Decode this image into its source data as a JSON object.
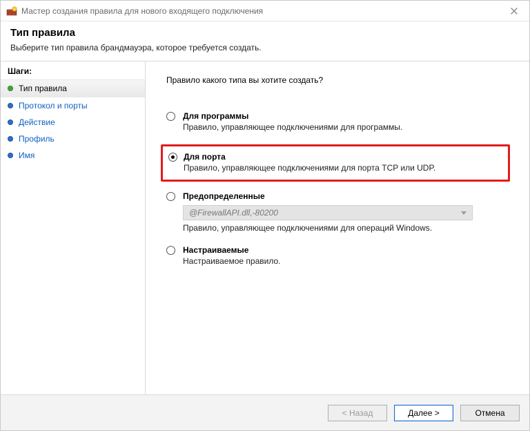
{
  "window": {
    "title": "Мастер создания правила для нового входящего подключения"
  },
  "header": {
    "title": "Тип правила",
    "subtitle": "Выберите тип правила брандмауэра, которое требуется создать."
  },
  "sidebar": {
    "steps_label": "Шаги:",
    "steps": [
      {
        "label": "Тип правила",
        "state": "active"
      },
      {
        "label": "Протокол и порты",
        "state": "link"
      },
      {
        "label": "Действие",
        "state": "link"
      },
      {
        "label": "Профиль",
        "state": "link"
      },
      {
        "label": "Имя",
        "state": "link"
      }
    ]
  },
  "content": {
    "question": "Правило какого типа вы хотите создать?",
    "options": [
      {
        "id": "program",
        "title": "Для программы",
        "desc": "Правило, управляющее подключениями для программы.",
        "checked": false,
        "highlight": false
      },
      {
        "id": "port",
        "title": "Для порта",
        "desc": "Правило, управляющее подключениями для порта TCP или UDP.",
        "checked": true,
        "highlight": true
      },
      {
        "id": "predefined",
        "title": "Предопределенные",
        "select_value": "@FirewallAPI.dll,-80200",
        "desc": "Правило, управляющее подключениями для операций Windows.",
        "checked": false,
        "highlight": false
      },
      {
        "id": "custom",
        "title": "Настраиваемые",
        "desc": "Настраиваемое правило.",
        "checked": false,
        "highlight": false
      }
    ]
  },
  "footer": {
    "back": "< Назад",
    "next": "Далее >",
    "cancel": "Отмена"
  }
}
